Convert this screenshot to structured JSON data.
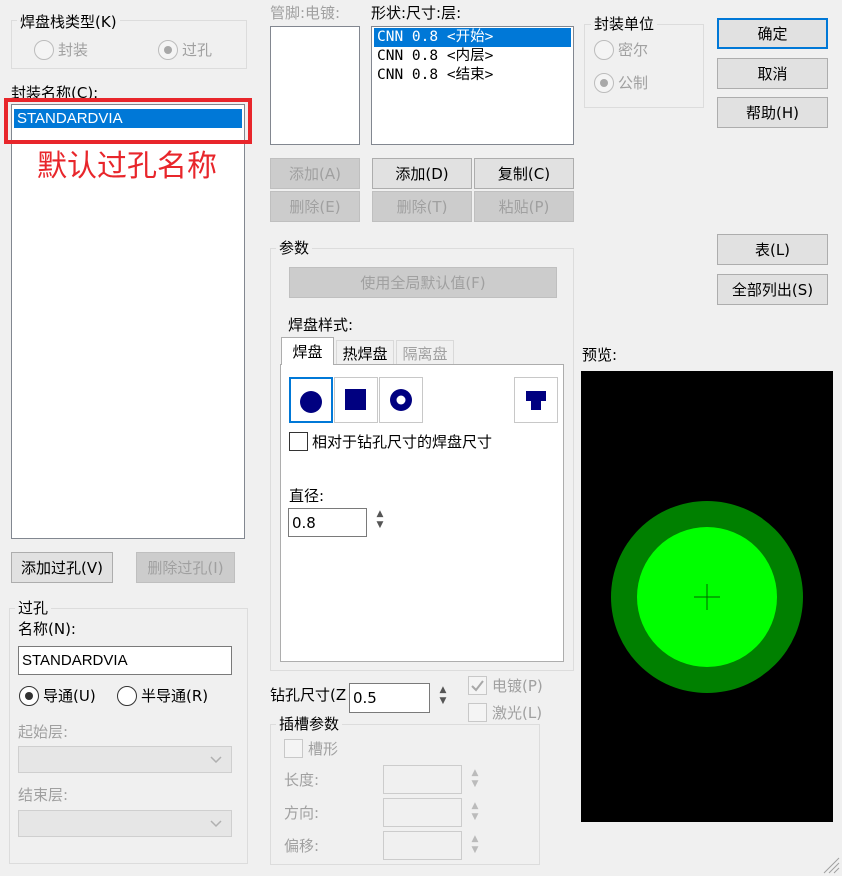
{
  "pad_stack_type": {
    "title": "焊盘栈类型(K)",
    "options": [
      {
        "label": "封装",
        "checked": false,
        "enabled": false
      },
      {
        "label": "过孔",
        "checked": true,
        "enabled": false
      }
    ]
  },
  "package_name": {
    "label": "封装名称(C):",
    "items": [
      "STANDARDVIA"
    ],
    "selected_index": 0,
    "annotation": "默认过孔名称",
    "add_via_button": "添加过孔(V)",
    "delete_via_button": "删除过孔(I)"
  },
  "pin_plating": {
    "label": "管脚:电镀:",
    "add_button": "添加(A)",
    "delete_button": "删除(E)"
  },
  "shape_list": {
    "label": "形状:尺寸:层:",
    "items": [
      "CNN 0.8 <开始>",
      "CNN 0.8 <内层>",
      "CNN 0.8 <结束>"
    ],
    "selected_index": 0,
    "add_button": "添加(D)",
    "copy_button": "复制(C)",
    "delete_button": "删除(T)",
    "paste_button": "粘贴(P)"
  },
  "units": {
    "title": "封装单位",
    "options": [
      {
        "label": "密尔",
        "checked": false,
        "enabled": false
      },
      {
        "label": "公制",
        "checked": true,
        "enabled": false
      }
    ]
  },
  "actions": {
    "ok": "确定",
    "cancel": "取消",
    "help": "帮助(H)",
    "table": "表(L)",
    "list_all": "全部列出(S)"
  },
  "params": {
    "title": "参数",
    "use_global_defaults": "使用全局默认值(F)",
    "pad_style_label": "焊盘样式:",
    "tabs": [
      {
        "label": "焊盘",
        "active": true,
        "enabled": true
      },
      {
        "label": "热焊盘",
        "active": false,
        "enabled": true
      },
      {
        "label": "隔离盘",
        "active": false,
        "enabled": false
      }
    ],
    "pad_shapes": [
      "round-pad-icon",
      "square-pad-icon",
      "annular-pad-icon",
      "custom-pad-icon"
    ],
    "relative_checkbox": "相对于钻孔尺寸的焊盘尺寸",
    "relative_checked": false,
    "diameter_label": "直径:",
    "diameter_value": "0.8"
  },
  "drill": {
    "label": "钻孔尺寸(Z",
    "value": "0.5",
    "plated_label": "电镀(P)",
    "plated_checked": true,
    "laser_label": "激光(L)",
    "laser_checked": false
  },
  "slot": {
    "title": "插槽参数",
    "slotted_label": "槽形",
    "length_label": "长度:",
    "direction_label": "方向:",
    "offset_label": "偏移:"
  },
  "preview": {
    "label": "预览:",
    "colors": {
      "background": "#000000",
      "outer_ring": "#008000",
      "inner_pad": "#00ff00",
      "crosshair": "#006400"
    }
  },
  "via": {
    "title": "过孔",
    "name_label": "名称(N):",
    "name_value": "STANDARDVIA",
    "options": [
      {
        "label": "导通(U)",
        "checked": true
      },
      {
        "label": "半导通(R)",
        "checked": false
      }
    ],
    "start_layer_label": "起始层:",
    "end_layer_label": "结束层:"
  },
  "colors": {
    "accent": "#0078d7",
    "annotation": "#e8262b"
  }
}
